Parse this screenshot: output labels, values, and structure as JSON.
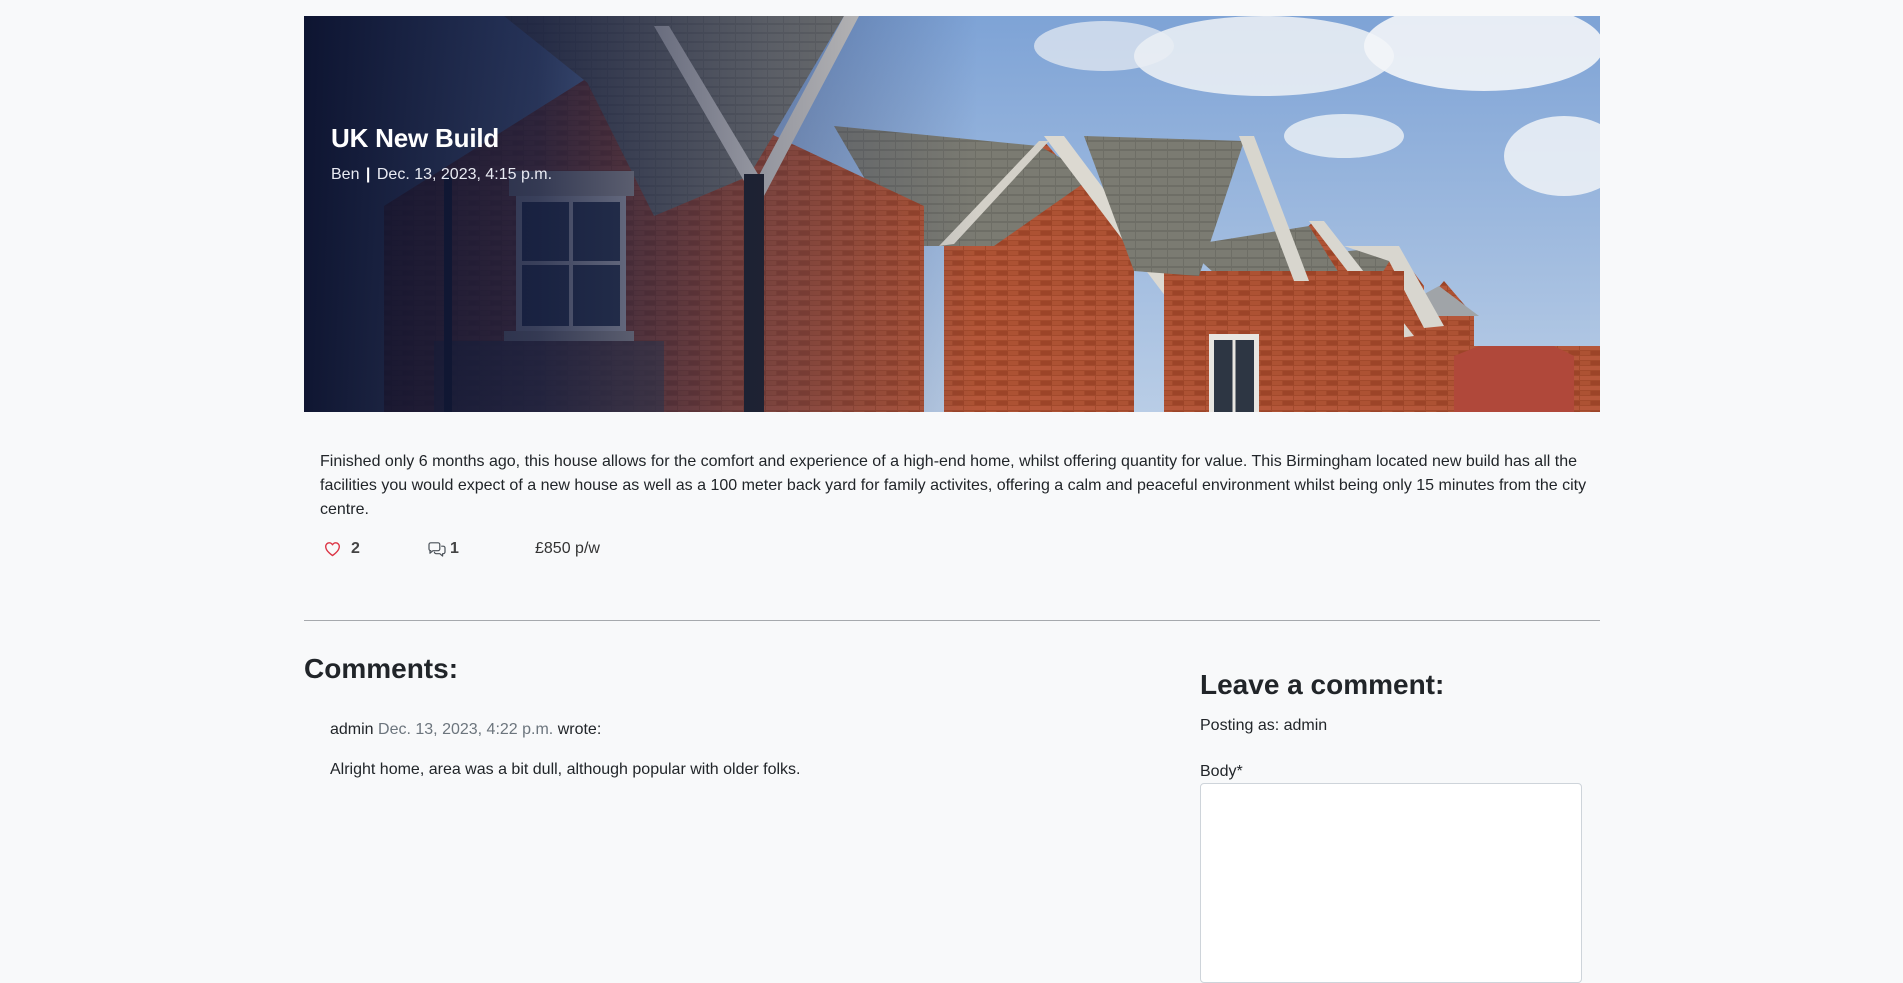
{
  "post": {
    "title": "UK New Build",
    "author": "Ben",
    "separator": "|",
    "date": "Dec. 13, 2023, 4:15 p.m.",
    "hero_image": "terraced-brick-houses-photo",
    "body": "Finished only 6 months ago, this house allows for the comfort and experience of a high-end home, whilst offering quantity for value. This Birmingham located new build has all the facilities you would expect of  a new house as well as a 100 meter back yard for family activites, offering a calm and peaceful environment whilst being only 15 minutes from the city centre.",
    "likes": "2",
    "comment_count": "1",
    "price": "£850 p/w"
  },
  "icons": {
    "like": "heart-icon",
    "comments": "chat-bubbles-icon"
  },
  "colors": {
    "heart": "#dc3545",
    "background": "#f8f9fa",
    "muted_text": "#6c757d"
  },
  "comments": {
    "heading": "Comments:",
    "items": [
      {
        "author": "admin",
        "date": "Dec. 13, 2023, 4:22 p.m.",
        "wrote": "wrote:",
        "body": "Alright home, area was a bit dull, although popular with older folks."
      }
    ]
  },
  "comment_form": {
    "heading": "Leave a comment:",
    "posting_as": "Posting as: admin",
    "body_label": "Body*",
    "body_value": ""
  }
}
